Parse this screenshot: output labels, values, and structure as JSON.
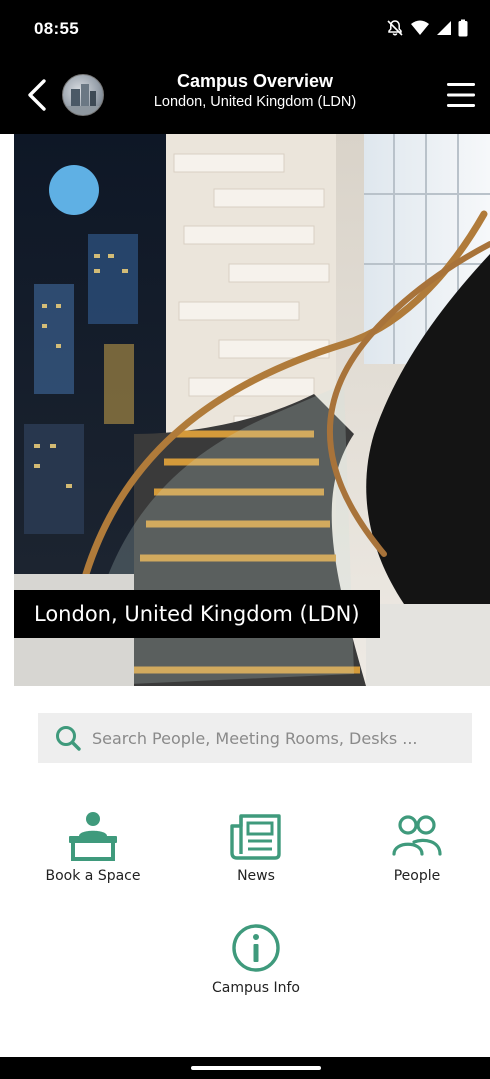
{
  "status_bar": {
    "time": "08:55",
    "icons": [
      "bell-muted-icon",
      "wifi-icon",
      "signal-icon",
      "battery-icon"
    ]
  },
  "app_bar": {
    "title": "Campus Overview",
    "subtitle": "London, United Kingdom (LDN)",
    "icons": [
      "back-icon",
      "campus-avatar",
      "menu-icon"
    ]
  },
  "hero": {
    "caption": "London, United Kingdom (LDN)"
  },
  "search": {
    "placeholder": "Search People, Meeting Rooms, Desks ..."
  },
  "tiles": [
    {
      "label": "Book a Space",
      "icon": "desk-person-icon"
    },
    {
      "label": "News",
      "icon": "newspaper-icon"
    },
    {
      "label": "People",
      "icon": "people-icon"
    },
    {
      "label": "Campus Info",
      "icon": "info-icon"
    }
  ],
  "colors": {
    "accent": "#3f9a7c",
    "bar_background": "#000000",
    "search_background": "#eeeeee",
    "placeholder_text": "#8a8a8a"
  }
}
